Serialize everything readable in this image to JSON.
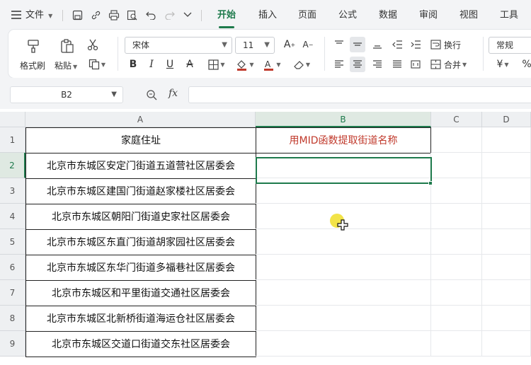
{
  "menubar": {
    "file_label": "文件",
    "tabs": [
      {
        "label": "开始",
        "active": true
      },
      {
        "label": "插入",
        "active": false
      },
      {
        "label": "页面",
        "active": false
      },
      {
        "label": "公式",
        "active": false
      },
      {
        "label": "数据",
        "active": false
      },
      {
        "label": "审阅",
        "active": false
      },
      {
        "label": "视图",
        "active": false
      },
      {
        "label": "工具",
        "active": false
      }
    ],
    "quick_access_icons": [
      "save-icon",
      "link-icon",
      "print-icon",
      "print-preview-icon",
      "undo-icon",
      "redo-icon",
      "more-icon"
    ]
  },
  "ribbon": {
    "format_painter_label": "格式刷",
    "paste_label": "粘贴",
    "font_name": "宋体",
    "font_size": "11",
    "wrap_text_label": "换行",
    "merge_label": "合并",
    "number_format": "常规",
    "currency_symbol": "¥",
    "percent_symbol": "%",
    "font_color": "#c0392b",
    "fill_color": "#c0392b"
  },
  "formula_bar": {
    "name_box": "B2",
    "fx_label": "fx",
    "formula": ""
  },
  "sheet": {
    "columns": [
      "A",
      "B",
      "C",
      "D"
    ],
    "rows": [
      "1",
      "2",
      "3",
      "4",
      "5",
      "6",
      "7",
      "8",
      "9"
    ],
    "header_a": "家庭住址",
    "header_b": "用MID函数提取街道名称",
    "addresses": [
      "北京市东城区安定门街道五道营社区居委会",
      "北京市东城区建国门街道赵家楼社区居委会",
      "北京市东城区朝阳门街道史家社区居委会",
      "北京市东城区东直门街道胡家园社区居委会",
      "北京市东城区东华门街道多福巷社区居委会",
      "北京市东城区和平里街道交通社区居委会",
      "北京市东城区北新桥街道海运仓社区居委会",
      "北京市东城区交道口街道交东社区居委会"
    ],
    "selected_cell": "B2",
    "accent_color": "#1e7a4c"
  }
}
